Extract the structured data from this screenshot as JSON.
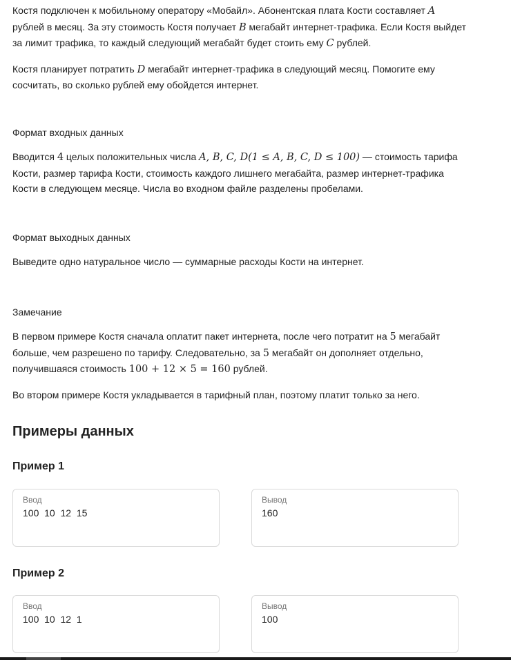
{
  "statement": {
    "p1_a": "Костя подключен к мобильному оператору «Мобайл». Абонентская плата Кости составляет ",
    "p1_var_a": "A",
    "p1_b": " рублей в месяц. За эту стоимость Костя получает ",
    "p1_var_b": "B",
    "p1_c": " мегабайт интернет-трафика. Если Костя выйдет за лимит трафика, то каждый следующий мегабайт будет стоить ему ",
    "p1_var_c": "C",
    "p1_d": " рублей.",
    "p2_a": "Костя планирует потратить ",
    "p2_var_d": "D",
    "p2_b": " мегабайт интернет-трафика в следующий месяц. Помогите ему сосчитать, во сколько рублей ему обойдется интернет."
  },
  "input_format": {
    "title": "Формат входных данных",
    "t1": "Вводится ",
    "num": "4",
    "t2": " целых положительных числа ",
    "math": "A, B, C, D(1 ≤ A, B, C, D ≤ 100)",
    "t3": " — стоимость тарифа Кости, размер тарифа Кости, стоимость каждого лишнего мегабайта, размер интернет-трафика Кости в следующем месяце. Числа во входном файле разделены пробелами."
  },
  "output_format": {
    "title": "Формат выходных данных",
    "text": "Выведите одно натуральное число — суммарные расходы Кости на интернет."
  },
  "note": {
    "title": "Замечание",
    "p1_a": "В первом примере Костя сначала оплатит пакет интернета, после чего потратит на ",
    "p1_n1": "5",
    "p1_b": " мегабайт больше, чем разрешено по тарифу. Следовательно, за ",
    "p1_n2": "5",
    "p1_c": " мегабайт он дополняет отдельно, получившаяся стоимость ",
    "p1_expr": "100 + 12 × 5 = 160",
    "p1_d": " рублей.",
    "p2": "Во втором примере Костя укладывается в тарифный план, поэтому платит только за него."
  },
  "examples": {
    "title": "Примеры данных",
    "items": [
      {
        "title": "Пример 1",
        "input_label": "Ввод",
        "input": "100  10  12  15",
        "output_label": "Вывод",
        "output": "160"
      },
      {
        "title": "Пример 2",
        "input_label": "Ввод",
        "input": "100  10  12  1",
        "output_label": "Вывод",
        "output": "100"
      }
    ]
  }
}
